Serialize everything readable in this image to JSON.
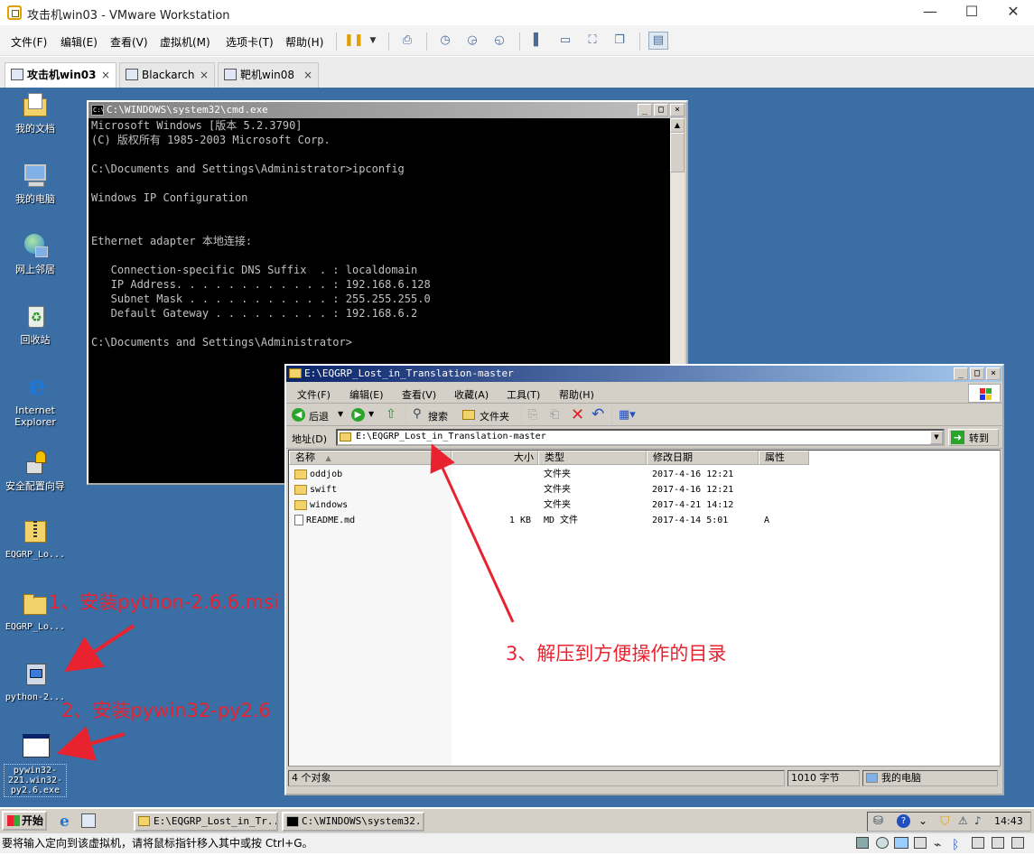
{
  "window": {
    "title": "攻击机win03 - VMware Workstation",
    "min": "—",
    "max": "☐",
    "close": "✕"
  },
  "menu": [
    "文件(F)",
    "编辑(E)",
    "查看(V)",
    "虚拟机(M)",
    "选项卡(T)",
    "帮助(H)"
  ],
  "tabs": [
    {
      "label": "攻击机win03",
      "close": "×"
    },
    {
      "label": "Blackarch",
      "close": "×"
    },
    {
      "label": "靶机win08",
      "close": "×"
    }
  ],
  "desktop_icons": [
    {
      "label": "我的文档"
    },
    {
      "label": "我的电脑"
    },
    {
      "label": "网上邻居"
    },
    {
      "label": "回收站"
    },
    {
      "label": "Internet Explorer"
    },
    {
      "label": "安全配置向导"
    },
    {
      "label": "EQGRP_Lo..."
    },
    {
      "label": "EQGRP_Lo..."
    },
    {
      "label": "python-2..."
    },
    {
      "label": "pywin32-221.win32-py2.6.exe"
    }
  ],
  "cmd": {
    "title": "C:\\WINDOWS\\system32\\cmd.exe",
    "lines": [
      "Microsoft Windows [版本 5.2.3790]",
      "(C) 版权所有 1985-2003 Microsoft Corp.",
      "",
      "C:\\Documents and Settings\\Administrator>ipconfig",
      "",
      "Windows IP Configuration",
      "",
      "",
      "Ethernet adapter 本地连接:",
      "",
      "   Connection-specific DNS Suffix  . : localdomain",
      "   IP Address. . . . . . . . . . . . : 192.168.6.128",
      "   Subnet Mask . . . . . . . . . . . : 255.255.255.0",
      "   Default Gateway . . . . . . . . . : 192.168.6.2",
      "",
      "C:\\Documents and Settings\\Administrator>"
    ]
  },
  "explorer": {
    "title": "E:\\EQGRP_Lost_in_Translation-master",
    "menu": [
      "文件(F)",
      "编辑(E)",
      "查看(V)",
      "收藏(A)",
      "工具(T)",
      "帮助(H)"
    ],
    "toolbar": {
      "back": "后退",
      "search": "搜索",
      "folders": "文件夹"
    },
    "address_label": "地址(D)",
    "address": "E:\\EQGRP_Lost_in_Translation-master",
    "go": "转到",
    "columns": {
      "name": "名称",
      "size": "大小",
      "type": "类型",
      "date": "修改日期",
      "attr": "属性"
    },
    "files": [
      {
        "name": "oddjob",
        "size": "",
        "type": "文件夹",
        "date": "2017-4-16 12:21",
        "attr": ""
      },
      {
        "name": "swift",
        "size": "",
        "type": "文件夹",
        "date": "2017-4-16 12:21",
        "attr": ""
      },
      {
        "name": "windows",
        "size": "",
        "type": "文件夹",
        "date": "2017-4-21 14:12",
        "attr": ""
      },
      {
        "name": "README.md",
        "size": "1 KB",
        "type": "MD 文件",
        "date": "2017-4-14 5:01",
        "attr": "A"
      }
    ],
    "status_count": "4 个对象",
    "status_size": "1010 字节",
    "status_location": "我的电脑"
  },
  "annotations": {
    "a1": "1、安装python-2.6.6.msi",
    "a2": "2、安装pywin32-py2.6",
    "a3": "3、解压到方便操作的目录"
  },
  "taskbar": {
    "start": "开始",
    "items": [
      "E:\\EQGRP_Lost_in_Tr...",
      "C:\\WINDOWS\\system32..."
    ],
    "time": "14:43"
  },
  "statusbar": "要将输入定向到该虚拟机，请将鼠标指针移入其中或按 Ctrl+G。",
  "colors": {
    "desktop": "#3a6ea5",
    "annotation": "#e8232f",
    "caption": "#0a246a"
  }
}
